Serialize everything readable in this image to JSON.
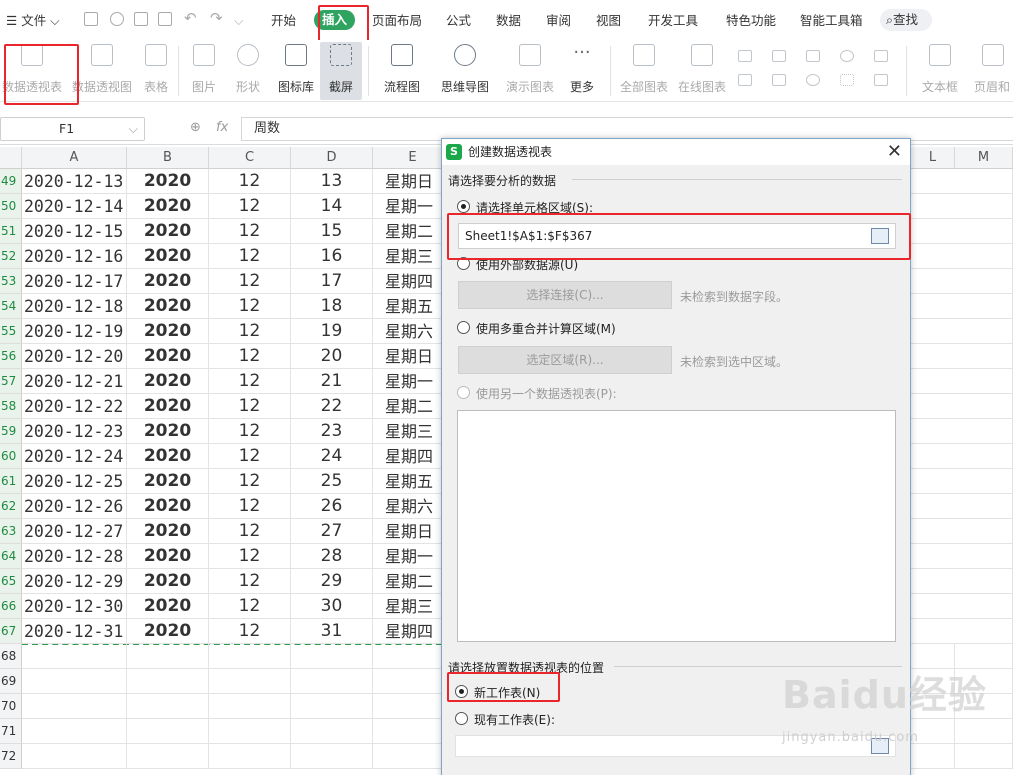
{
  "menu": {
    "file_label": "文件",
    "tabs": [
      "开始",
      "插入",
      "页面布局",
      "公式",
      "数据",
      "审阅",
      "视图",
      "开发工具",
      "特色功能",
      "智能工具箱"
    ],
    "active_tab": "插入",
    "search_label": "查找"
  },
  "toolbar": {
    "tools": [
      {
        "label": "数据透视表",
        "enabled": false
      },
      {
        "label": "数据透视图",
        "enabled": false
      },
      {
        "label": "表格",
        "enabled": false
      },
      {
        "label": "图片",
        "enabled": false
      },
      {
        "label": "形状",
        "enabled": false
      },
      {
        "label": "图标库",
        "enabled": true
      },
      {
        "label": "截屏",
        "enabled": true
      },
      {
        "label": "流程图",
        "enabled": true
      },
      {
        "label": "思维导图",
        "enabled": true
      },
      {
        "label": "演示图表",
        "enabled": false
      },
      {
        "label": "更多",
        "enabled": true
      },
      {
        "label": "全部图表",
        "enabled": false
      },
      {
        "label": "在线图表",
        "enabled": false
      },
      {
        "label": "文本框",
        "enabled": false
      },
      {
        "label": "页眉和",
        "enabled": false
      }
    ]
  },
  "formula_bar": {
    "cell_ref": "F1",
    "fx_label": "fx",
    "content": "周数"
  },
  "grid": {
    "columns": [
      "A",
      "B",
      "C",
      "D",
      "E",
      "L",
      "M"
    ],
    "rows": [
      {
        "num": "49",
        "a": "2020-12-13",
        "b": "2020",
        "c": "12",
        "d": "13",
        "e": "星期日"
      },
      {
        "num": "50",
        "a": "2020-12-14",
        "b": "2020",
        "c": "12",
        "d": "14",
        "e": "星期一"
      },
      {
        "num": "51",
        "a": "2020-12-15",
        "b": "2020",
        "c": "12",
        "d": "15",
        "e": "星期二"
      },
      {
        "num": "52",
        "a": "2020-12-16",
        "b": "2020",
        "c": "12",
        "d": "16",
        "e": "星期三"
      },
      {
        "num": "53",
        "a": "2020-12-17",
        "b": "2020",
        "c": "12",
        "d": "17",
        "e": "星期四"
      },
      {
        "num": "54",
        "a": "2020-12-18",
        "b": "2020",
        "c": "12",
        "d": "18",
        "e": "星期五"
      },
      {
        "num": "55",
        "a": "2020-12-19",
        "b": "2020",
        "c": "12",
        "d": "19",
        "e": "星期六"
      },
      {
        "num": "56",
        "a": "2020-12-20",
        "b": "2020",
        "c": "12",
        "d": "20",
        "e": "星期日"
      },
      {
        "num": "57",
        "a": "2020-12-21",
        "b": "2020",
        "c": "12",
        "d": "21",
        "e": "星期一"
      },
      {
        "num": "58",
        "a": "2020-12-22",
        "b": "2020",
        "c": "12",
        "d": "22",
        "e": "星期二"
      },
      {
        "num": "59",
        "a": "2020-12-23",
        "b": "2020",
        "c": "12",
        "d": "23",
        "e": "星期三"
      },
      {
        "num": "60",
        "a": "2020-12-24",
        "b": "2020",
        "c": "12",
        "d": "24",
        "e": "星期四"
      },
      {
        "num": "61",
        "a": "2020-12-25",
        "b": "2020",
        "c": "12",
        "d": "25",
        "e": "星期五"
      },
      {
        "num": "62",
        "a": "2020-12-26",
        "b": "2020",
        "c": "12",
        "d": "26",
        "e": "星期六"
      },
      {
        "num": "63",
        "a": "2020-12-27",
        "b": "2020",
        "c": "12",
        "d": "27",
        "e": "星期日"
      },
      {
        "num": "64",
        "a": "2020-12-28",
        "b": "2020",
        "c": "12",
        "d": "28",
        "e": "星期一"
      },
      {
        "num": "65",
        "a": "2020-12-29",
        "b": "2020",
        "c": "12",
        "d": "29",
        "e": "星期二"
      },
      {
        "num": "66",
        "a": "2020-12-30",
        "b": "2020",
        "c": "12",
        "d": "30",
        "e": "星期三"
      },
      {
        "num": "67",
        "a": "2020-12-31",
        "b": "2020",
        "c": "12",
        "d": "31",
        "e": "星期四"
      }
    ],
    "empty_rows": [
      "68",
      "69",
      "70",
      "71",
      "72"
    ]
  },
  "dialog": {
    "title": "创建数据透视表",
    "close_glyph": "✕",
    "section1_label": "请选择要分析的数据",
    "opt_select_range": "请选择单元格区域(S):",
    "range_value": "Sheet1!$A$1:$F$367",
    "opt_external": "使用外部数据源(U)",
    "btn_select_connection": "选择连接(C)...",
    "note_no_fields": "未检索到数据字段。",
    "opt_multi_consolidate": "使用多重合并计算区域(M)",
    "btn_select_region": "选定区域(R)...",
    "note_no_region": "未检索到选中区域。",
    "opt_other_pivot": "使用另一个数据透视表(P):",
    "section2_label": "请选择放置数据透视表的位置",
    "opt_new_sheet": "新工作表(N)",
    "opt_existing_sheet": "现有工作表(E):"
  },
  "watermark": {
    "brand": "Baidu经验",
    "url": "jingyan.baidu.com"
  },
  "colors": {
    "accent_green": "#2fa360",
    "highlight_red": "#e8262c",
    "row_header_highlight": "#1e8b3e"
  }
}
